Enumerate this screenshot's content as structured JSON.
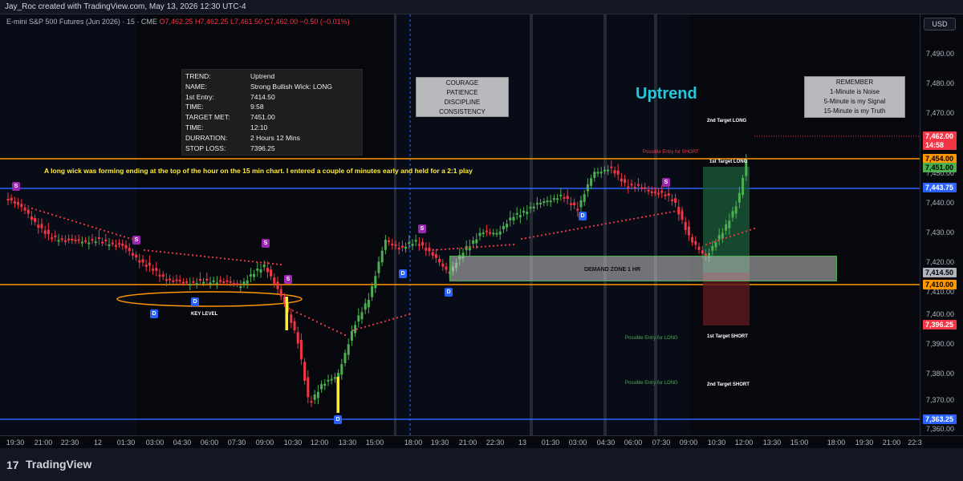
{
  "header": {
    "creator": "Jay_Roc created with TradingView.com, May 13, 2026 12:30 UTC-4"
  },
  "symbol": {
    "name": "E-mini S&P 500 Futures (Jun 2026) · 15 · CME",
    "ohlc": "O7,462.25 H7,462.25 L7,461.50 C7,462.00 −0.50 (−0.01%)"
  },
  "price_scale": {
    "currency_button": "USD",
    "ticks": [
      "7,490.00",
      "7,480.00",
      "7,470.00",
      "7,460.00",
      "7,450.00",
      "7,440.00",
      "7,430.00",
      "7,420.00",
      "7,410.00",
      "7,400.00",
      "7,390.00",
      "7,380.00",
      "7,370.00",
      "7,360.00"
    ],
    "labels": {
      "last": "7,462.00",
      "countdown": "14:58",
      "l7454": "7,454.00",
      "l7451": "7,451.00",
      "l7443": "7,443.75",
      "l7414": "7,414.50",
      "l7410": "7,410.00",
      "l7396": "7,396.25",
      "l7363": "7,363.25"
    }
  },
  "time_axis": [
    "19:30",
    "21:00",
    "22:30",
    "12",
    "01:30",
    "03:00",
    "04:30",
    "06:00",
    "07:30",
    "09:00",
    "10:30",
    "12:00",
    "13:30",
    "15:00",
    "18:00",
    "19:30",
    "21:00",
    "22:30",
    "13",
    "01:30",
    "03:00",
    "04:30",
    "06:00",
    "07:30",
    "09:00",
    "10:30",
    "12:00",
    "13:30",
    "15:00",
    "18:00",
    "19:30",
    "21:00",
    "22:3"
  ],
  "trade_info": [
    {
      "k": "TREND:",
      "v": "Uptrend"
    },
    {
      "k": "NAME:",
      "v": "Strong Bullish Wick: LONG"
    },
    {
      "k": "1st Entry:",
      "v": "7414.50"
    },
    {
      "k": "TIME:",
      "v": "9:58"
    },
    {
      "k": "TARGET MET:",
      "v": "7451.00"
    },
    {
      "k": "TIME:",
      "v": "12:10"
    },
    {
      "k": "DURRATION:",
      "v": "  2 Hours 12  Mins"
    },
    {
      "k": "STOP LOSS:",
      "v": "7396.25"
    }
  ],
  "mindset_box": [
    "COURAGE",
    "PATIENCE",
    "DISCIPLINE",
    "CONSISTENCY"
  ],
  "remember_box": [
    "REMEMBER",
    "1-Minute is Noise",
    "5-Minute is my Signal",
    "15-Minute is my Truth"
  ],
  "trend_label": "Uptrend",
  "note": "A long wick was forming ending at the top of the hour on the 15 min chart.  I entered a couple of minutes early and held for a 2:1 play",
  "annotations": {
    "second_target_long": "2nd Target LONG",
    "first_target_long": "1st  Target LONG",
    "possible_short": "Possible Entry for SHORT",
    "first_target_short": "1st Target SHORT",
    "second_target_short": "2nd Target SHORT",
    "possible_long_1": "Possible Entry for LONG",
    "possible_long_2": "Possible Entry for LONG",
    "key_level": "KEY LEVEL",
    "demand_zone": "DEMAND ZONE 1 HR"
  },
  "badges": {
    "s": "S",
    "d": "D"
  },
  "footer": {
    "logo_mark": "17",
    "logo_text": "TradingView"
  },
  "colors": {
    "bull": "#4caf50",
    "bear": "#f23645",
    "orange_line": "#ff9800",
    "blue_line": "#2962ff",
    "trend_text": "#26c6da",
    "stop_marker": "#f23645"
  }
}
